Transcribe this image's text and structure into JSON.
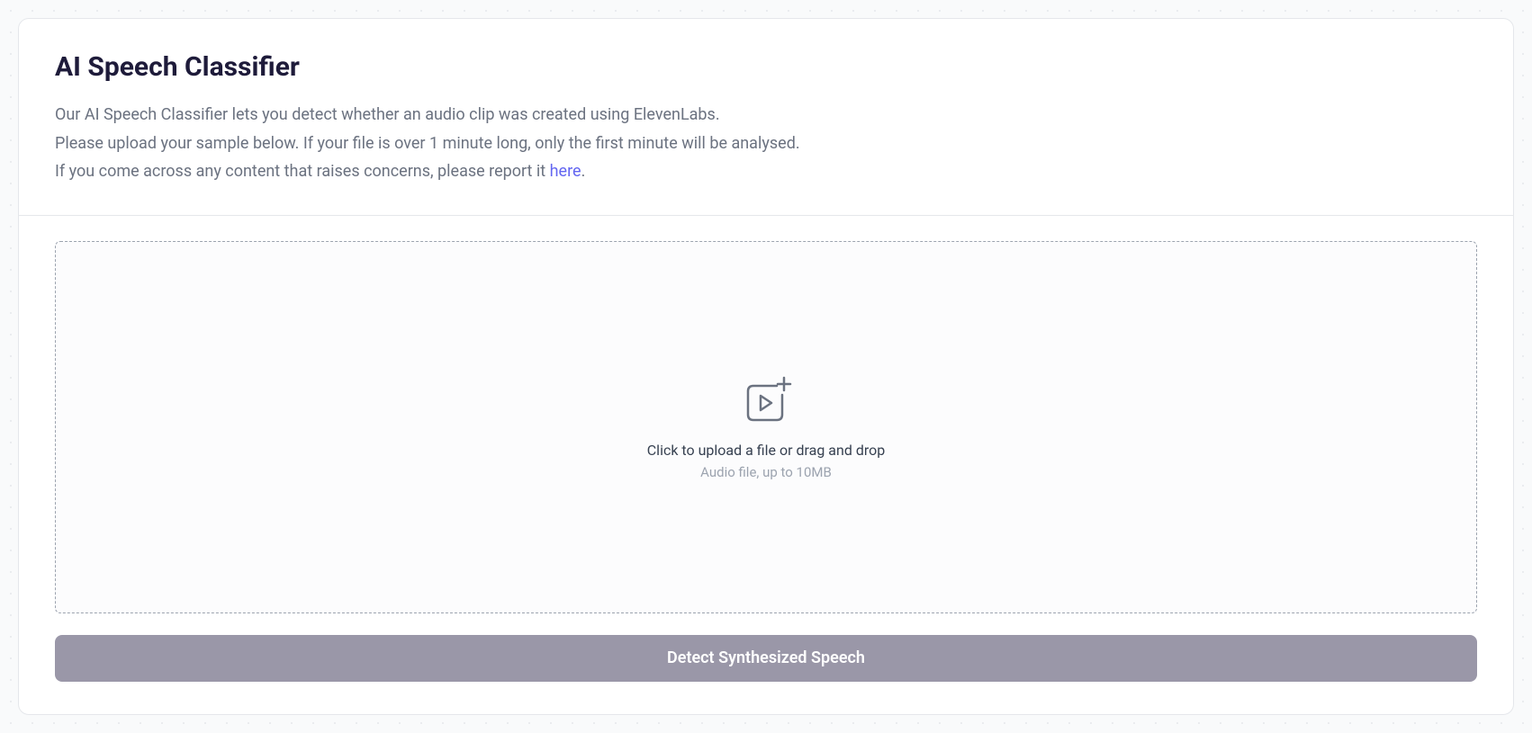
{
  "header": {
    "title": "AI Speech Classifier",
    "description_line1": "Our AI Speech Classifier lets you detect whether an audio clip was created using ElevenLabs.",
    "description_line2": "Please upload your sample below. If your file is over 1 minute long, only the first minute will be analysed.",
    "description_line3_prefix": "If you come across any content that raises concerns, please report it ",
    "description_link_text": "here",
    "description_line3_suffix": "."
  },
  "dropzone": {
    "primary_text": "Click to upload a file or drag and drop",
    "secondary_text": "Audio file, up to 10MB"
  },
  "actions": {
    "detect_label": "Detect Synthesized Speech"
  }
}
